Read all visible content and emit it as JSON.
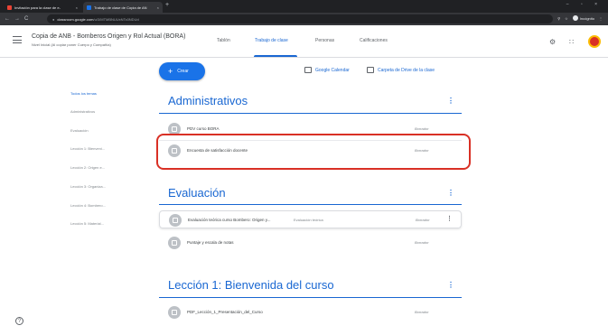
{
  "browser": {
    "tabs": [
      {
        "title": "Invitación para la clase de e-",
        "close": "×"
      },
      {
        "title": "Trabajo de clase de Copia de AN",
        "close": "×"
      }
    ],
    "new_tab": "+",
    "window_controls": "– ▫ ×",
    "nav": {
      "back": "←",
      "forward": "→",
      "reload": "C"
    },
    "url": {
      "host": "classroom.google.com",
      "path": "/u/3/MTMBNUUxNTc0NDUd"
    },
    "incognito_label": "Incógnito"
  },
  "header": {
    "course_title": "Copia de ANB - Bomberos Origen y Rol Actual (BORA)",
    "course_subtitle": "Nivel Inicial (Al copiar poner Cuerpo y Compañía)",
    "tabs": [
      "Tablón",
      "Trabajo de clase",
      "Personas",
      "Calificaciones"
    ]
  },
  "sidebar": {
    "topics": [
      "Todos los temas",
      "Administrativos",
      "Evaluación",
      "Lección 1: Bienveni...",
      "Lección 2: Origen e...",
      "Lección 3: Organiza...",
      "Lección 4: Bombero...",
      "Lección 5: Material..."
    ]
  },
  "toolbar": {
    "create_label": "Crear",
    "calendar_label": "Google Calendar",
    "drive_label": "Carpeta de Drive de la clase"
  },
  "sections": [
    {
      "title": "Administrativos",
      "items": [
        {
          "label": "PDV curso BORA",
          "status": "Borrador"
        },
        {
          "label": "Encuesta de satisfacción docente",
          "status": "Borrador"
        }
      ]
    },
    {
      "title": "Evaluación",
      "items": [
        {
          "label": "Evaluación teórica curso Bombero: Origen y...",
          "topic_tag": "Evaluación teórica",
          "status": "Borrador"
        },
        {
          "label": "Puntaje y escala de notas",
          "status": "Borrador"
        }
      ]
    },
    {
      "title": "Lección 1: Bienvenida del curso",
      "items": [
        {
          "label": "PDF_Lección_1_Presentación_del_Curso",
          "status": "Borrador"
        }
      ]
    }
  ],
  "colors": {
    "accent": "#1967d2",
    "create_button": "#1a73e8",
    "highlight": "#d93025"
  },
  "icons": [
    "menu-icon",
    "apps-icon",
    "account-avatar-icon",
    "calendar-icon",
    "folder-icon",
    "help-icon",
    "more-vert-icon",
    "assignment-icon"
  ]
}
